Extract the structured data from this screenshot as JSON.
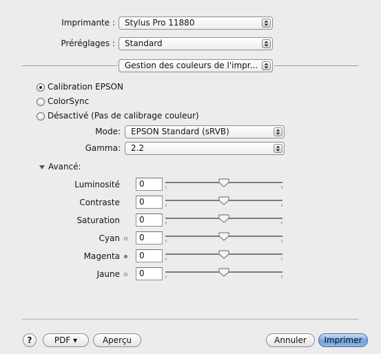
{
  "printer": {
    "label": "Imprimante :",
    "value": "Stylus Pro 11880"
  },
  "presets": {
    "label": "Préréglages :",
    "value": "Standard"
  },
  "panel": {
    "value": "Gestion des couleurs de l'impr..."
  },
  "color_mode": {
    "options": [
      {
        "label": "Calibration EPSON",
        "selected": true
      },
      {
        "label": "ColorSync",
        "selected": false
      },
      {
        "label": "Désactivé (Pas de calibrage couleur)",
        "selected": false
      }
    ]
  },
  "mode": {
    "label": "Mode:",
    "value": "EPSON Standard (sRVB)"
  },
  "gamma": {
    "label": "Gamma:",
    "value": "2.2"
  },
  "advanced": {
    "label": "Avancé:",
    "expanded": true
  },
  "adjustments": [
    {
      "label": "Luminosité",
      "value": "0",
      "indicator": null
    },
    {
      "label": "Contraste",
      "value": "0",
      "indicator": null
    },
    {
      "label": "Saturation",
      "value": "0",
      "indicator": null
    },
    {
      "label": "Cyan",
      "value": "0",
      "indicator": "hollow"
    },
    {
      "label": "Magenta",
      "value": "0",
      "indicator": "filled"
    },
    {
      "label": "Jaune",
      "value": "0",
      "indicator": "hollow"
    }
  ],
  "footer": {
    "help_label": "?",
    "pdf_label": "PDF ▾",
    "preview_label": "Aperçu",
    "cancel_label": "Annuler",
    "print_label": "Imprimer"
  }
}
